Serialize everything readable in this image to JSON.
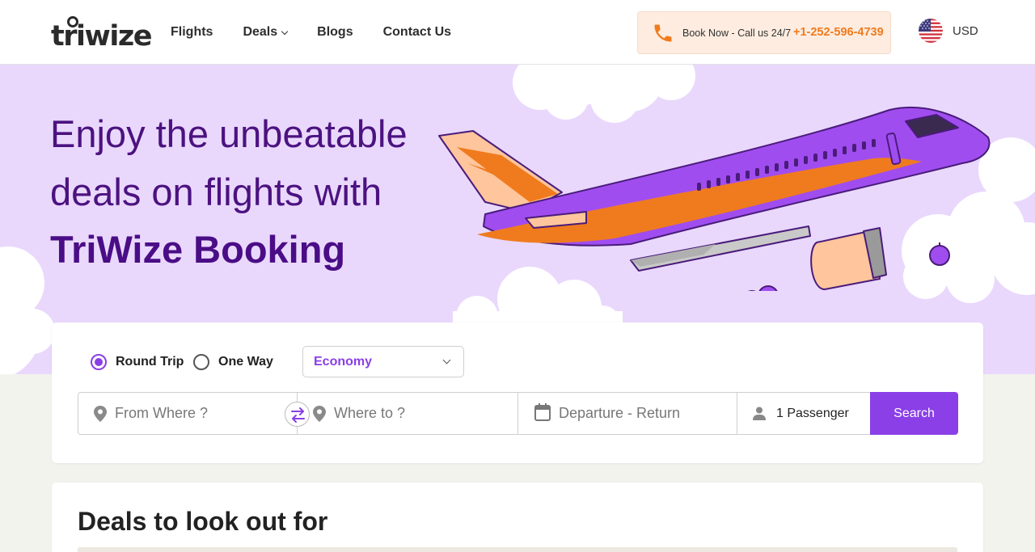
{
  "header": {
    "logo": "triwize",
    "nav": [
      {
        "label": "Flights"
      },
      {
        "label": "Deals"
      },
      {
        "label": "Blogs"
      },
      {
        "label": "Contact Us"
      }
    ],
    "call_text": "Book Now - Call us 24/7",
    "call_number": "+1-252-596-4739",
    "currency": "USD",
    "flag_icon": "us-flag-icon",
    "phone_icon": "phone-icon"
  },
  "hero": {
    "line1": "Enjoy the unbeatable",
    "line2": "deals on flights with",
    "line3": "TriWize Booking"
  },
  "search": {
    "trip_types": [
      {
        "label": "Round Trip",
        "selected": true
      },
      {
        "label": "One Way",
        "selected": false
      }
    ],
    "cabin_class": "Economy",
    "from_placeholder": "From Where ?",
    "to_placeholder": "Where to ?",
    "dates_placeholder": "Departure - Return",
    "passengers": "1 Passenger",
    "search_label": "Search"
  },
  "deals": {
    "title": "Deals to look out for"
  },
  "colors": {
    "accent": "#8b3fe6",
    "hero_bg": "#e9d8fc",
    "hero_text": "#4c1280",
    "phone_orange": "#f07b1e"
  }
}
